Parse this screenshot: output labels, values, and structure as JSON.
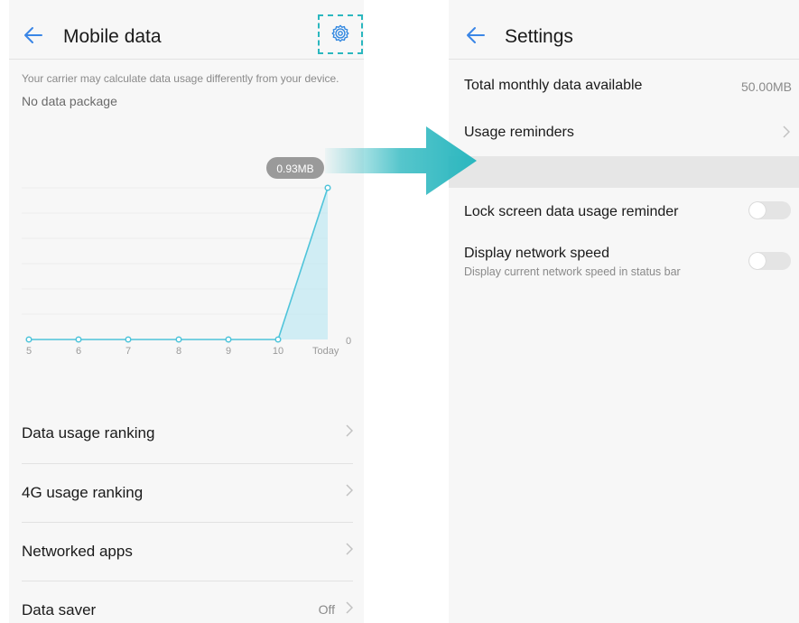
{
  "left_screen": {
    "title": "Mobile data",
    "notice": "Your carrier may calculate data usage differently from your device.",
    "package_status": "No data package",
    "chart_data": {
      "type": "area",
      "categories": [
        "5",
        "6",
        "7",
        "8",
        "9",
        "10",
        "Today"
      ],
      "values": [
        0,
        0,
        0,
        0,
        0,
        0,
        0.93
      ],
      "unit": "MB",
      "callout": "0.93MB",
      "y_label": "0",
      "grid": true,
      "colors": {
        "line": "#4fc4da",
        "fill": "#bfe8f2",
        "callout_bg": "#9a9a9a"
      }
    },
    "menu": [
      {
        "label": "Data usage ranking",
        "value": ""
      },
      {
        "label": "4G usage ranking",
        "value": ""
      },
      {
        "label": "Networked apps",
        "value": ""
      },
      {
        "label": "Data saver",
        "value": "Off"
      }
    ]
  },
  "right_screen": {
    "title": "Settings",
    "rows": {
      "monthly_data": {
        "label": "Total monthly data available",
        "value": "50.00MB"
      },
      "usage_reminders": {
        "label": "Usage reminders"
      },
      "lock_screen": {
        "label": "Lock screen data usage reminder",
        "enabled": false
      },
      "network_speed": {
        "label": "Display network speed",
        "sublabel": "Display current network speed in status bar",
        "enabled": false
      }
    }
  },
  "icons": {
    "back": "back-arrow-icon",
    "settings": "gear-icon",
    "chevron": "chevron-right-icon",
    "transition": "transition-arrow-icon"
  },
  "colors": {
    "accent": "#2bb7bf",
    "background": "#f7f7f7",
    "band": "#e6e6e6"
  }
}
